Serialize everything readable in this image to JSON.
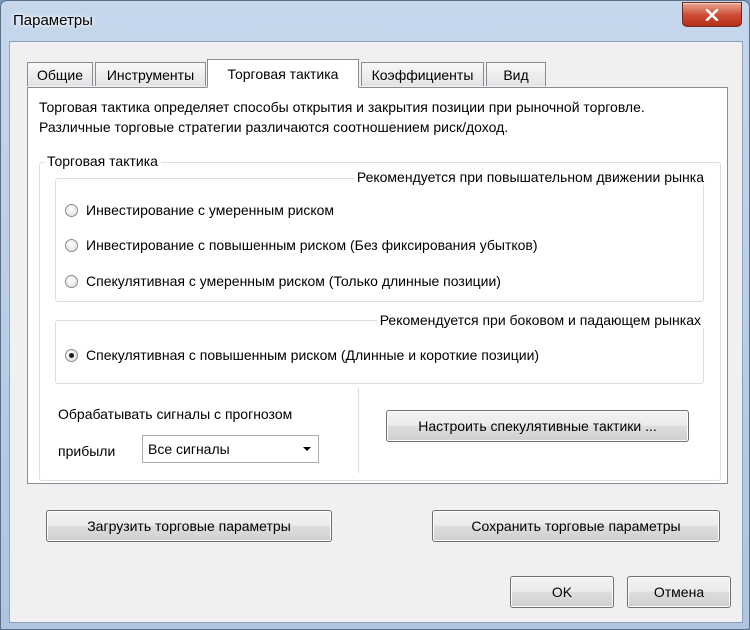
{
  "window": {
    "title": "Параметры"
  },
  "tabs": [
    {
      "label": "Общие",
      "active": false
    },
    {
      "label": "Инструменты",
      "active": false
    },
    {
      "label": "Торговая тактика",
      "active": true
    },
    {
      "label": "Коэффициенты",
      "active": false
    },
    {
      "label": "Вид",
      "active": false
    }
  ],
  "description": "Торговая тактика определяет способы открытия и закрытия позиции при рыночной торговле. Различные торговые стратегии различаются соотношением риск/доход.",
  "tactics_group": {
    "title": "Торговая тактика",
    "rising": {
      "title": "Рекомендуется при повышательном движении рынка",
      "options": [
        {
          "label": "Инвестирование с умеренным риском",
          "checked": false
        },
        {
          "label": "Инвестирование с повышенным риском  (Без фиксирования убытков)",
          "checked": false
        },
        {
          "label": "Спекулятивная с умеренным риском  (Только длинные позиции)",
          "checked": false
        }
      ]
    },
    "sideways": {
      "title": "Рекомендуется при боковом и падающем рынках",
      "options": [
        {
          "label": "Спекулятивная с повышенным риском  (Длинные и короткие позиции)",
          "checked": true
        }
      ]
    },
    "signals": {
      "label_line1": "Обрабатывать сигналы с прогнозом",
      "label_line2": "прибыли",
      "selected": "Все сигналы"
    },
    "configure_button": "Настроить спекулятивные тактики ..."
  },
  "footer": {
    "load_button": "Загрузить торговые параметры",
    "save_button": "Сохранить торговые параметры",
    "ok_button": "OK",
    "cancel_button": "Отмена"
  },
  "icons": {
    "close": "close-icon",
    "dropdown": "chevron-down-icon"
  },
  "colors": {
    "title_bar": "#b9cde6",
    "close_button": "#c8452e",
    "panel_background": "#ffffff",
    "dialog_background": "#f0f0f0"
  }
}
